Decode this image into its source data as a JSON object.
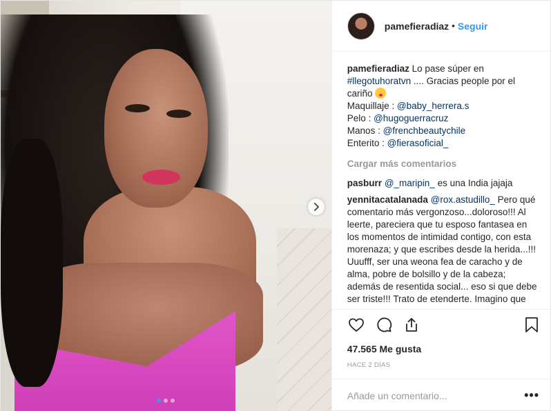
{
  "post": {
    "author": "pamefieradiaz",
    "follow_label": "Seguir",
    "separator": "•",
    "carousel": {
      "total": 3,
      "active_index": 0
    },
    "icons": {
      "next": "chevron-right-icon",
      "like": "heart-icon",
      "comment": "comment-icon",
      "share": "share-icon",
      "save": "bookmark-icon",
      "more": "more-options-icon"
    }
  },
  "caption": {
    "user": "pamefieradiaz",
    "text_1": "Lo pase súper en",
    "hashtag": "#llegotuhoratvn",
    "text_2": ".... Gracias people por el cariño",
    "emoji": "face-savoring-food-emoji",
    "lines": [
      {
        "label": "Maquillaje :",
        "mention": "@baby_herrera.s"
      },
      {
        "label": "Pelo :",
        "mention": "@hugoguerracruz"
      },
      {
        "label": "Manos :",
        "mention": "@frenchbeautychile"
      },
      {
        "label": "Enterito :",
        "mention": "@fierasoficial_"
      }
    ]
  },
  "load_more": "Cargar más comentarios",
  "comments": [
    {
      "user": "pasburr",
      "mention": "@_maripin_",
      "text": "es una India jajaja"
    },
    {
      "user": "yennitacatalanada",
      "mention": "@rox.astudillo_",
      "text": "Pero qué comentario más vergonzoso...doloroso!!! Al leerte, pareciera que tu esposo fantasea en los momentos de intimidad contigo, con esta morenaza; y que escribes desde la herida...!!! Uuufff, ser una weona fea de caracho y de alma, pobre de bolsillo y de la cabeza; además de resentida social... eso si que debe ser triste!!! Trato de etenderte. Imagino que"
    }
  ],
  "likes": "47.565 Me gusta",
  "timestamp": "Hace 2 días",
  "add_comment_placeholder": "Añade un comentario...",
  "more_label": "•••",
  "colors": {
    "accent": "#3897f0",
    "link": "#003569",
    "muted": "#999999"
  }
}
